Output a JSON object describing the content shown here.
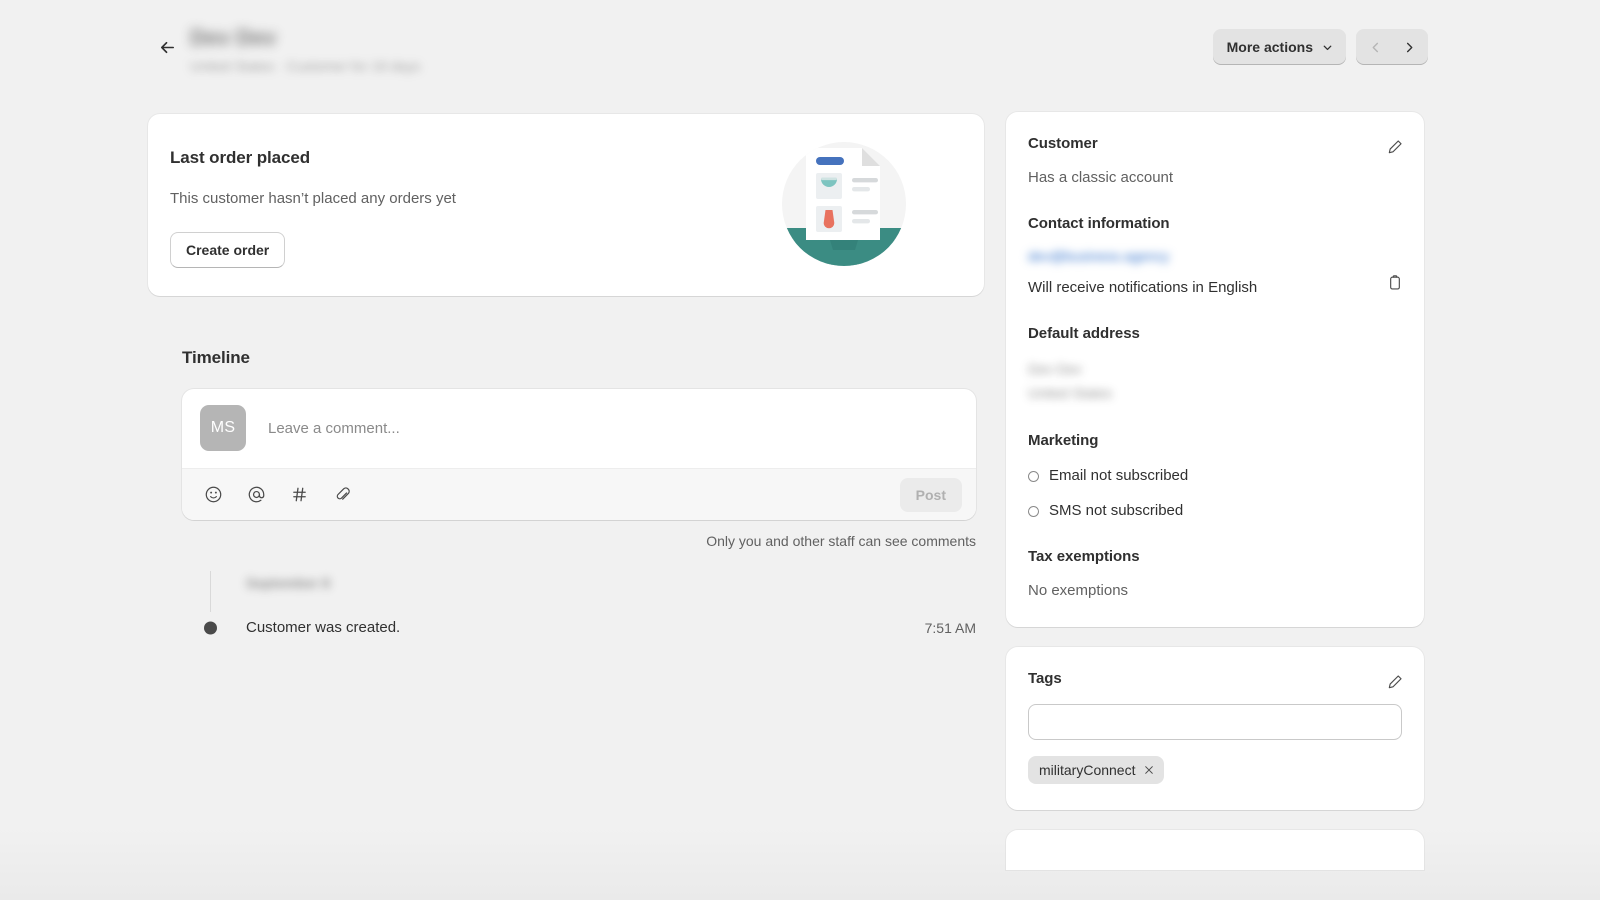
{
  "header": {
    "back_icon": "arrow-left-icon",
    "title": "Dev Dev",
    "subtitle": "United States · Customer for 18 days",
    "more_actions_label": "More actions",
    "chevron_icon": "chevron-down-icon",
    "prev_icon": "chevron-left-icon",
    "next_icon": "chevron-right-icon"
  },
  "last_order": {
    "heading": "Last order placed",
    "description": "This customer hasn’t placed any orders yet",
    "create_order_label": "Create order",
    "illustration": "empty-order-document-illustration",
    "illustration_colors": {
      "circle": "#f4f4f4",
      "base": "#3b8c83",
      "accent_blue": "#4572bd",
      "accent_teal": "#7dc4c0",
      "accent_red": "#e8725f"
    }
  },
  "timeline": {
    "title": "Timeline",
    "avatar_initials": "MS",
    "comment_placeholder": "Leave a comment...",
    "comment_value": "",
    "toolbar_icons": [
      "emoji-icon",
      "mention-icon",
      "hashtag-icon",
      "attachment-icon"
    ],
    "post_label": "Post",
    "privacy_note": "Only you and other staff can see comments",
    "events": [
      {
        "date": "September 8",
        "text": "Customer was created.",
        "time": "7:51 AM"
      }
    ]
  },
  "customer_card": {
    "edit_icon": "pencil-icon",
    "copy_icon": "clipboard-icon",
    "customer_heading": "Customer",
    "account_status": "Has a classic account",
    "contact_heading": "Contact information",
    "email": "dev@business.agency",
    "notification_language": "Will receive notifications in English",
    "address_heading": "Default address",
    "address_lines": [
      "Dev Dev",
      "United States"
    ],
    "marketing_heading": "Marketing",
    "marketing": [
      {
        "icon": "circle-outline-icon",
        "label": "Email not subscribed"
      },
      {
        "icon": "circle-outline-icon",
        "label": "SMS not subscribed"
      }
    ],
    "tax_heading": "Tax exemptions",
    "tax_status": "No exemptions"
  },
  "tags_card": {
    "heading": "Tags",
    "edit_icon": "pencil-icon",
    "input_value": "",
    "input_placeholder": "",
    "tags": [
      {
        "label": "militaryConnect",
        "remove_icon": "close-icon"
      }
    ]
  },
  "theme": {
    "background": "#f1f1f1",
    "surface": "#ffffff",
    "text_primary": "#303030",
    "text_secondary": "#616161",
    "link": "#2c6ecb",
    "control": "#e3e3e3"
  }
}
